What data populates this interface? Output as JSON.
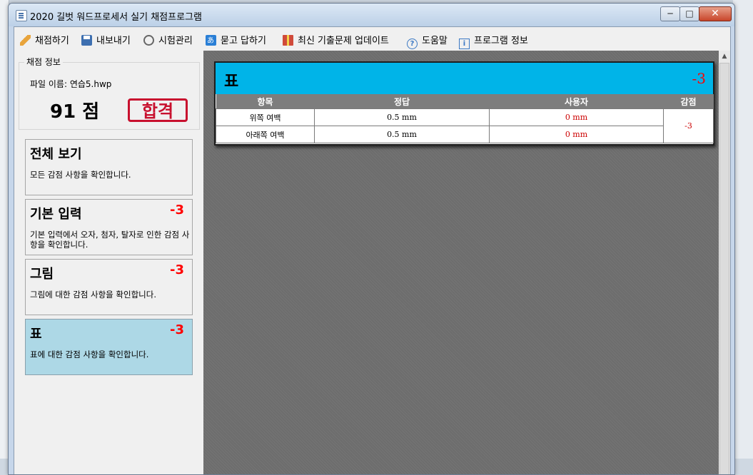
{
  "window": {
    "title": "2020 길벗 워드프로세서 실기 채점프로그램",
    "controls": {
      "minimize": "─",
      "maximize": "□",
      "close": "✕"
    }
  },
  "toolbar": {
    "items": [
      {
        "label": "채점하기",
        "icon": "pencil-icon"
      },
      {
        "label": "내보내기",
        "icon": "save-icon"
      },
      {
        "label": "시험관리",
        "icon": "timer-icon"
      },
      {
        "label": "묻고 답하기",
        "icon": "translate-icon"
      },
      {
        "label": "최신 기출문제 업데이트",
        "icon": "gift-icon"
      },
      {
        "label": "도움말",
        "icon": "help-icon"
      },
      {
        "label": "프로그램 정보",
        "icon": "info-icon"
      }
    ]
  },
  "scoring_info": {
    "legend": "채점 정보",
    "file_name": "파일 이름: 연습5.hwp",
    "score": "91 점",
    "result_stamp": "합격"
  },
  "categories": [
    {
      "title": "전체 보기",
      "deduction": "",
      "description": "모든 감점 사항을 확인합니다.",
      "selected": false
    },
    {
      "title": "기본 입력",
      "deduction": "-3",
      "description": "기본 입력에서 오자, 첨자, 탈자로 인한 감점 사항을 확인합니다.",
      "selected": false
    },
    {
      "title": "그림",
      "deduction": "-3",
      "description": "그림에 대한 감점 사항을 확인합니다.",
      "selected": false
    },
    {
      "title": "표",
      "deduction": "-3",
      "description": "표에 대한 감점 사항을 확인합니다.",
      "selected": true
    }
  ],
  "detail": {
    "title": "표",
    "deduction": "-3",
    "columns": [
      "항목",
      "정답",
      "사용자",
      "감점"
    ],
    "rows": [
      {
        "item": "위쪽 여백",
        "answer": "0.5 mm",
        "user": "0 mm"
      },
      {
        "item": "아래쪽 여백",
        "answer": "0.5 mm",
        "user": "0 mm"
      }
    ],
    "group_deduction": "-3"
  },
  "colors": {
    "header_cyan": "#00b4e8",
    "deduction_red": "#ff0000",
    "selected_card": "#add8e6",
    "table_header_gray": "#7d7d7d"
  }
}
